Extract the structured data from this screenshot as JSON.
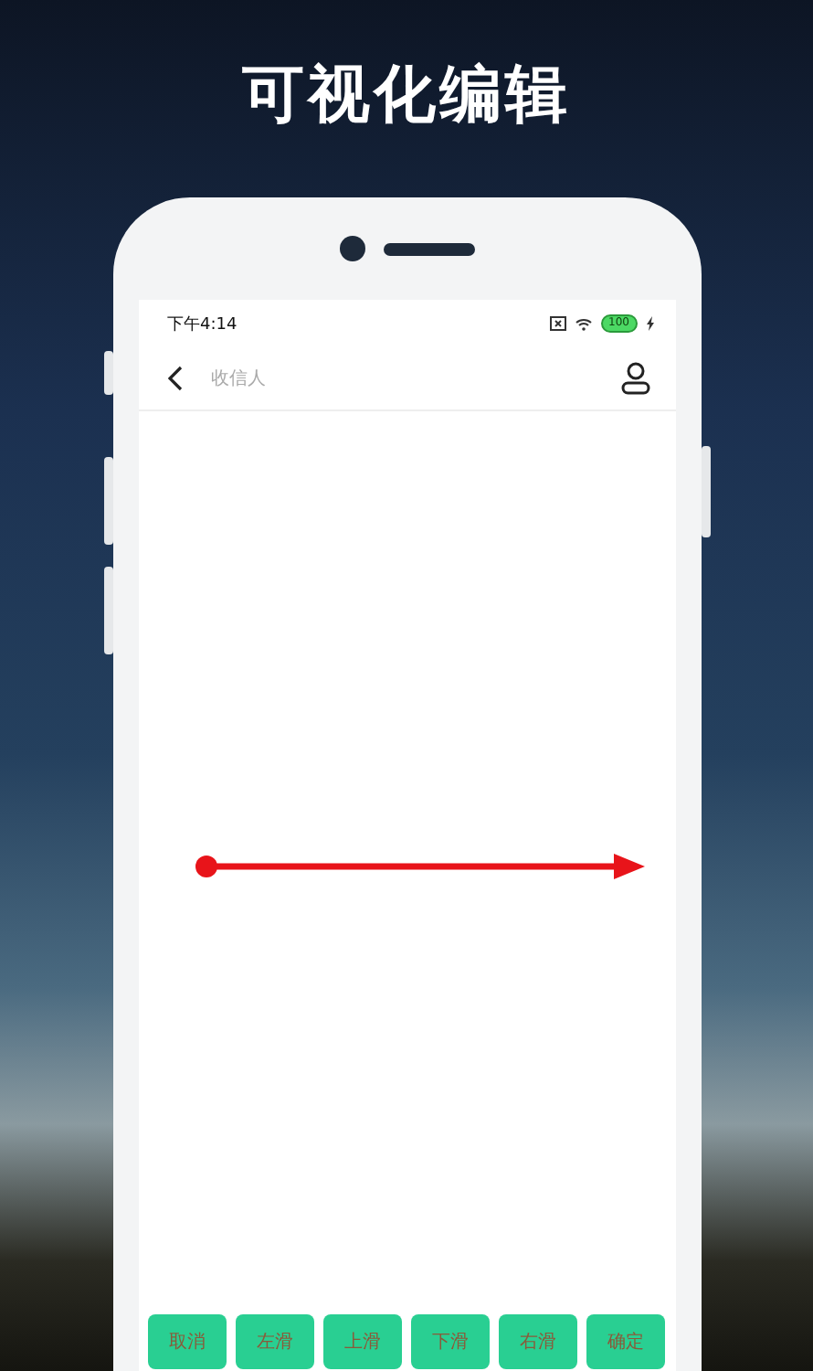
{
  "headline": "可视化编辑",
  "status_bar": {
    "time": "下午4:14",
    "battery": "100"
  },
  "nav_bar": {
    "title": "收信人"
  },
  "buttons": [
    {
      "label": "取消"
    },
    {
      "label": "左滑"
    },
    {
      "label": "上滑"
    },
    {
      "label": "下滑"
    },
    {
      "label": "右滑"
    },
    {
      "label": "确定"
    }
  ]
}
